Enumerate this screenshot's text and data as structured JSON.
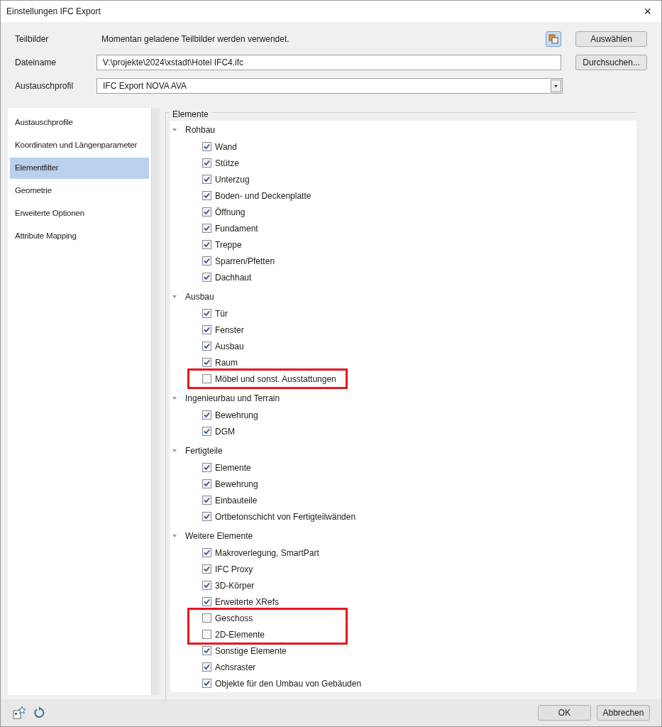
{
  "window": {
    "title": "Einstellungen IFC Export",
    "close": "×"
  },
  "form": {
    "teilbilder_label": "Teilbilder",
    "teilbilder_text": "Momentan geladene Teilbilder werden verwendet.",
    "select_button": "Auswählen",
    "dateiname_label": "Dateiname",
    "dateiname_value": "V:\\projekte\\2024\\xstadt\\Hotel IFC4.ifc",
    "browse_button": "Durchsuchen...",
    "profil_label": "Austauschprofil",
    "profil_value": "IFC Export NOVA AVA"
  },
  "sidebar": {
    "items": [
      {
        "label": "Austauschprofile",
        "selected": false
      },
      {
        "label": "Koordinaten und Längenparameter",
        "selected": false
      },
      {
        "label": "Elementfilter",
        "selected": true
      },
      {
        "label": "Geometrie",
        "selected": false
      },
      {
        "label": "Erweiterte Optionen",
        "selected": false
      },
      {
        "label": "Attribute Mapping",
        "selected": false
      }
    ]
  },
  "elements": {
    "title": "Elemente",
    "groups": [
      {
        "label": "Rohbau",
        "expanded": true,
        "children": [
          {
            "label": "Wand",
            "checked": true,
            "highlighted": false
          },
          {
            "label": "Stütze",
            "checked": true,
            "highlighted": false
          },
          {
            "label": "Unterzug",
            "checked": true,
            "highlighted": false
          },
          {
            "label": "Boden- und Deckenplatte",
            "checked": true,
            "highlighted": false
          },
          {
            "label": "Öffnung",
            "checked": true,
            "highlighted": false
          },
          {
            "label": "Fundament",
            "checked": true,
            "highlighted": false
          },
          {
            "label": "Treppe",
            "checked": true,
            "highlighted": false
          },
          {
            "label": "Sparren/Pfetten",
            "checked": true,
            "highlighted": false
          },
          {
            "label": "Dachhaut",
            "checked": true,
            "highlighted": false
          }
        ]
      },
      {
        "label": "Ausbau",
        "expanded": true,
        "children": [
          {
            "label": "Tür",
            "checked": true,
            "highlighted": false
          },
          {
            "label": "Fenster",
            "checked": true,
            "highlighted": false
          },
          {
            "label": "Ausbau",
            "checked": true,
            "highlighted": false
          },
          {
            "label": "Raum",
            "checked": true,
            "highlighted": false
          },
          {
            "label": "Möbel und sonst. Ausstattungen",
            "checked": false,
            "highlighted": true
          }
        ]
      },
      {
        "label": "Ingenieurbau und Terrain",
        "expanded": true,
        "children": [
          {
            "label": "Bewehrung",
            "checked": true,
            "highlighted": false
          },
          {
            "label": "DGM",
            "checked": true,
            "highlighted": false
          }
        ]
      },
      {
        "label": "Fertigteile",
        "expanded": true,
        "children": [
          {
            "label": "Elemente",
            "checked": true,
            "highlighted": false
          },
          {
            "label": "Bewehrung",
            "checked": true,
            "highlighted": false
          },
          {
            "label": "Einbauteile",
            "checked": true,
            "highlighted": false
          },
          {
            "label": "Ortbetonschicht von Fertigteilwänden",
            "checked": true,
            "highlighted": false
          }
        ]
      },
      {
        "label": "Weitere Elemente",
        "expanded": true,
        "children": [
          {
            "label": "Makroverlegung, SmartPart",
            "checked": true,
            "highlighted": false
          },
          {
            "label": "IFC Proxy",
            "checked": true,
            "highlighted": false
          },
          {
            "label": "3D-Körper",
            "checked": true,
            "highlighted": false
          },
          {
            "label": "Erweiterte XRefs",
            "checked": true,
            "highlighted": false
          },
          {
            "label": "Geschoss",
            "checked": false,
            "highlighted": true
          },
          {
            "label": "2D-Elemente",
            "checked": false,
            "highlighted": true
          },
          {
            "label": "Sonstige Elemente",
            "checked": true,
            "highlighted": false
          },
          {
            "label": "Achsraster",
            "checked": true,
            "highlighted": false
          },
          {
            "label": "Objekte für den Umbau von Gebäuden",
            "checked": true,
            "highlighted": false
          }
        ]
      }
    ]
  },
  "footer": {
    "ok": "OK",
    "cancel": "Abbrechen"
  }
}
